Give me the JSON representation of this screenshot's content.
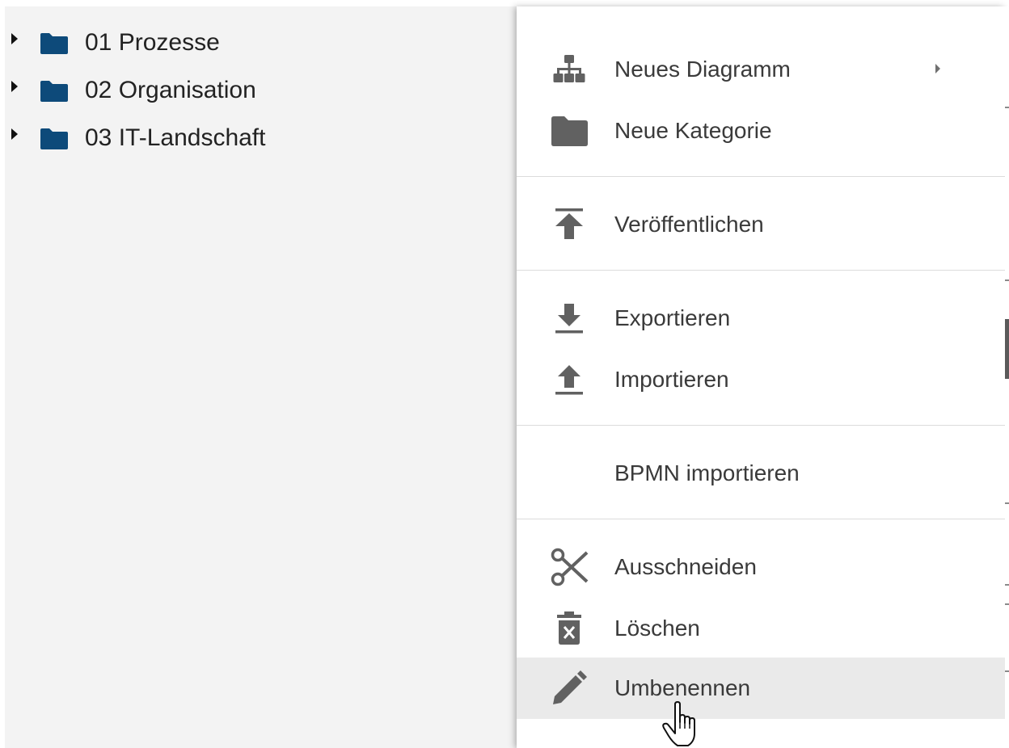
{
  "tree": {
    "items": [
      {
        "label": "01 Prozesse",
        "icon": "folder-icon",
        "toggle_icon": "caret-right-icon"
      },
      {
        "label": "02 Organisation",
        "icon": "folder-icon",
        "toggle_icon": "caret-right-icon"
      },
      {
        "label": "03 IT-Landschaft",
        "icon": "folder-icon",
        "toggle_icon": "caret-right-icon"
      }
    ],
    "folder_color": "#0d4a7a"
  },
  "context_menu": {
    "items": [
      {
        "label": "Neues Diagramm",
        "icon": "sitemap-icon",
        "has_submenu": true
      },
      {
        "label": "Neue Kategorie",
        "icon": "folder-icon",
        "has_submenu": false
      },
      {
        "label": "Veröffentlichen",
        "icon": "publish-icon",
        "has_submenu": false
      },
      {
        "label": "Exportieren",
        "icon": "download-icon",
        "has_submenu": false
      },
      {
        "label": "Importieren",
        "icon": "upload-icon",
        "has_submenu": false
      },
      {
        "label": "BPMN importieren",
        "icon": "",
        "has_submenu": false
      },
      {
        "label": "Ausschneiden",
        "icon": "scissors-icon",
        "has_submenu": false
      },
      {
        "label": "Löschen",
        "icon": "trash-icon",
        "has_submenu": false
      },
      {
        "label": "Umbenennen",
        "icon": "pencil-icon",
        "has_submenu": false,
        "hovered": true
      }
    ],
    "icon_color": "#616161",
    "hover_background": "#eaeaea"
  },
  "cursor": {
    "icon": "hand-pointer-icon"
  }
}
